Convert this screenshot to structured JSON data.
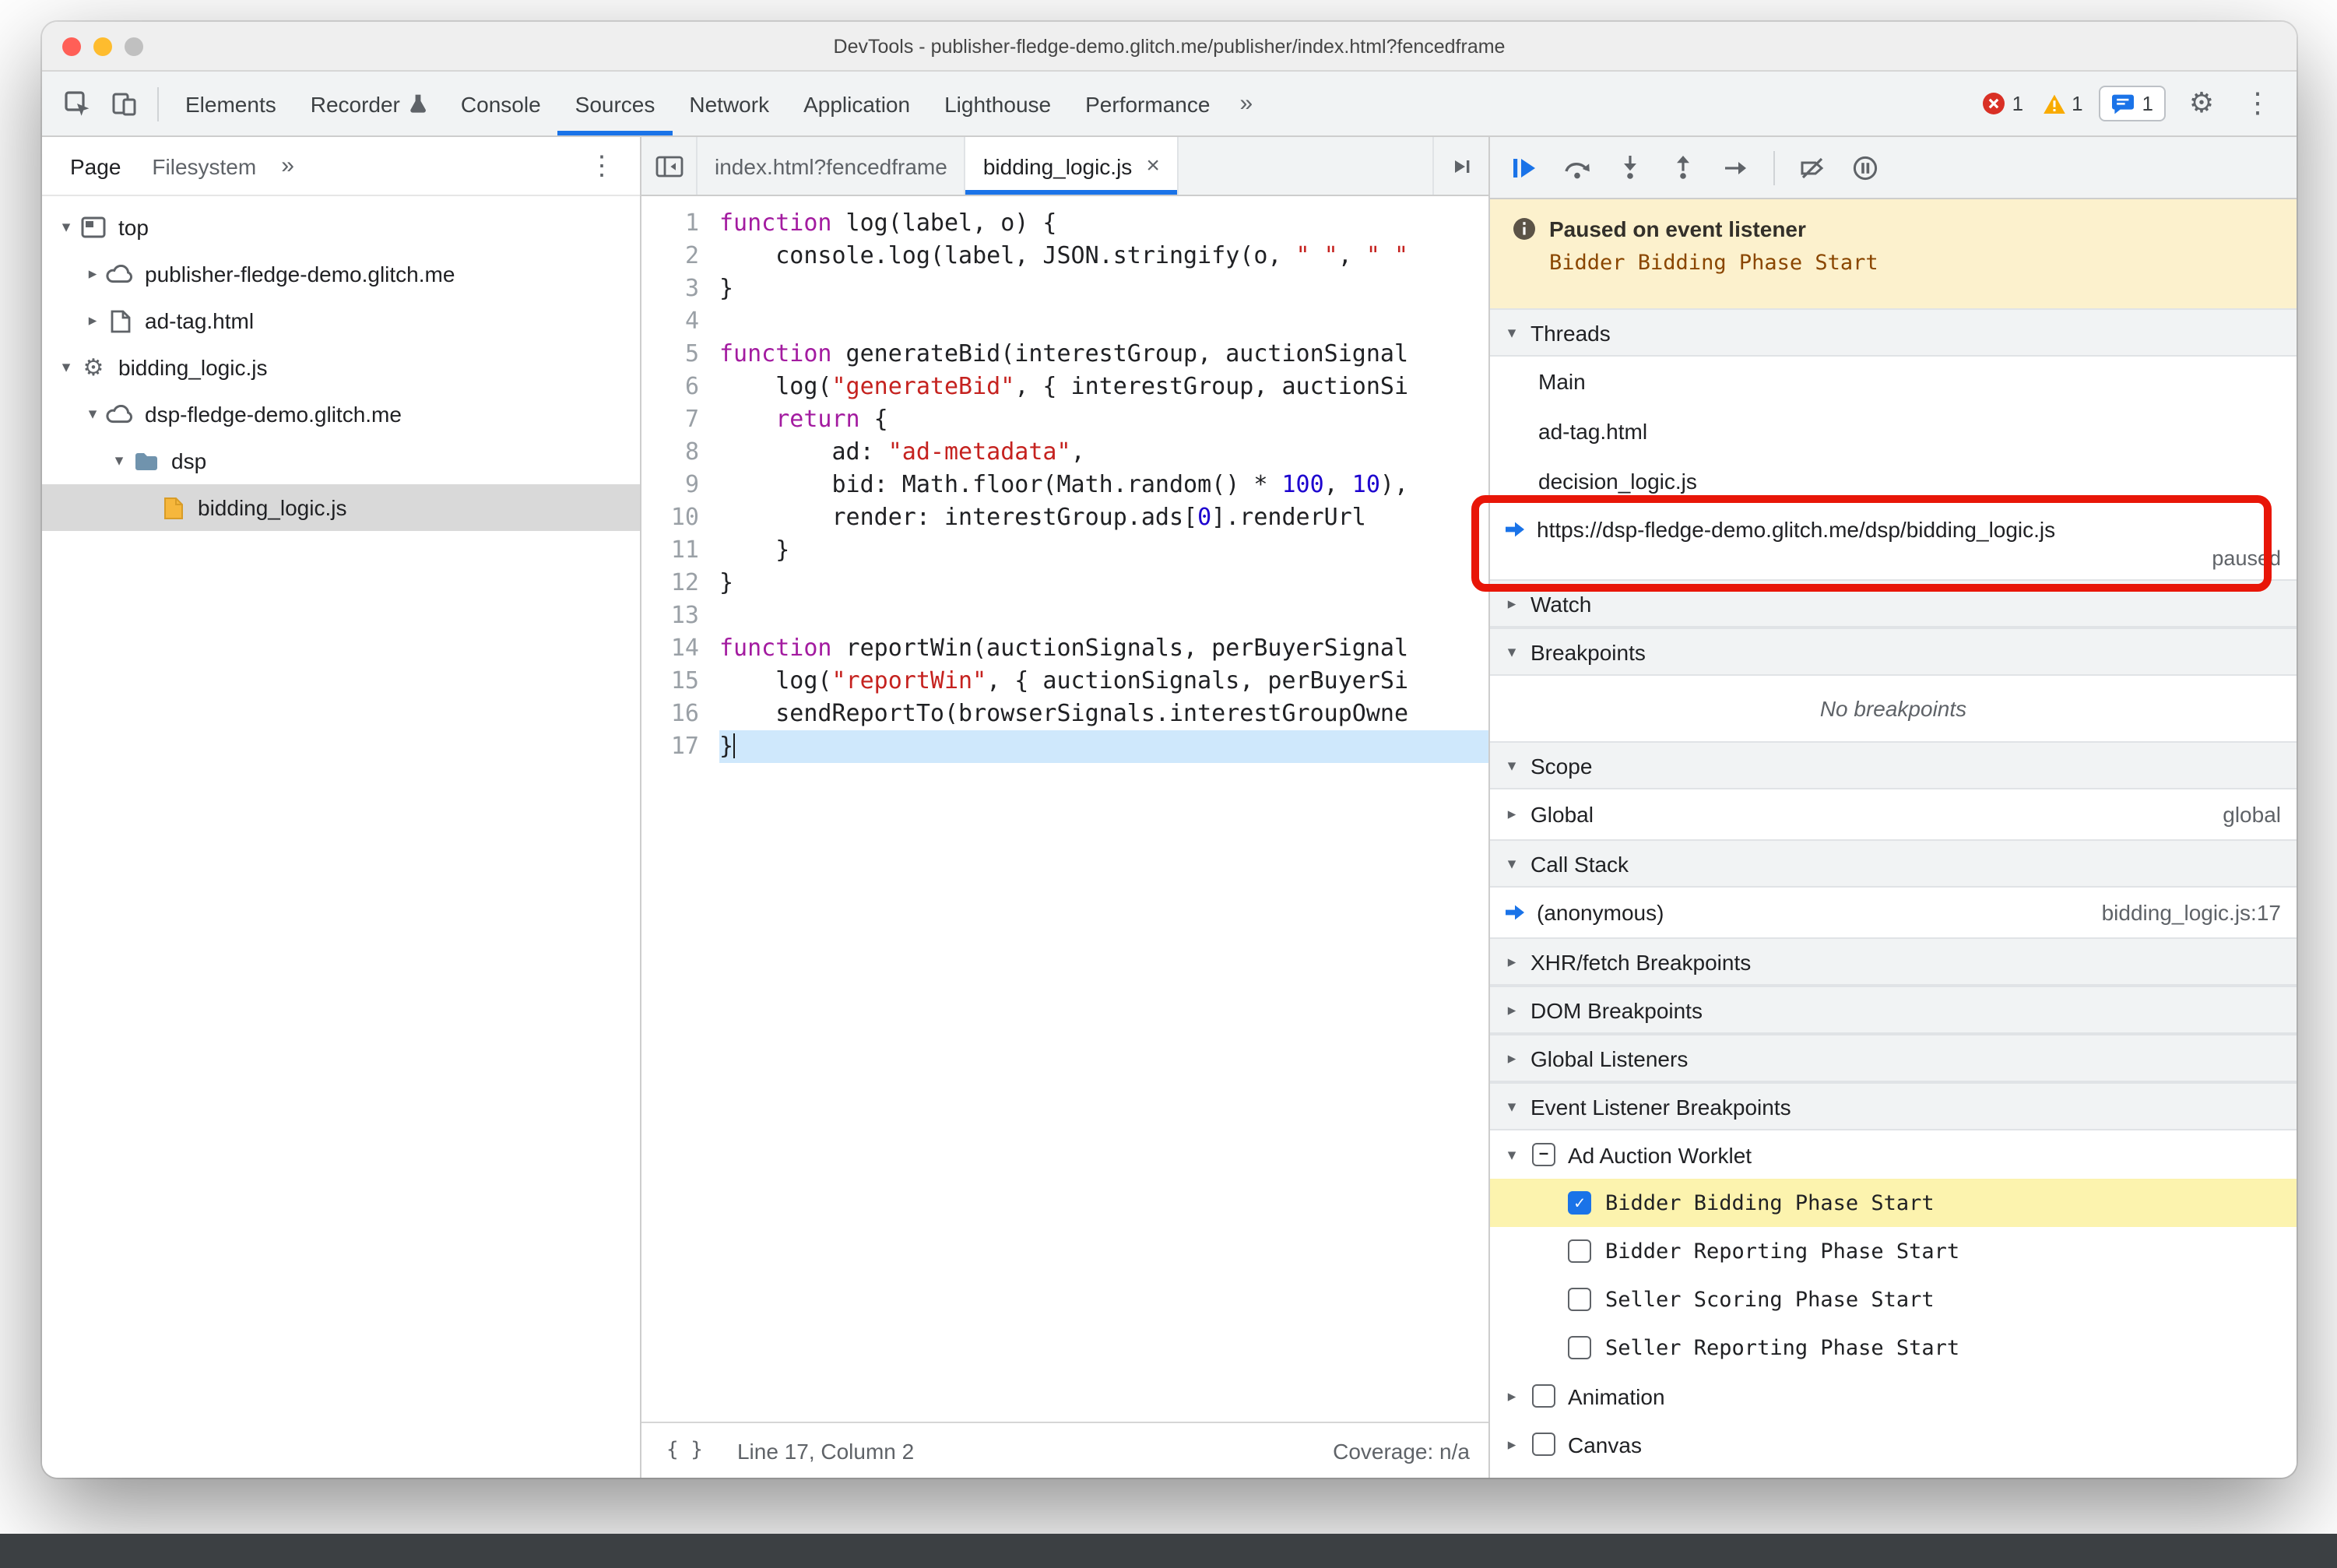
{
  "window": {
    "title": "DevTools - publisher-fledge-demo.glitch.me/publisher/index.html?fencedframe"
  },
  "colors": {
    "accent": "#1a73e8",
    "error_red": "#d93025",
    "warning_yellow": "#f9ab00",
    "annotation_red": "#e81608",
    "paused_banner_bg": "#fcf1cd",
    "paused_detail_text": "#8a4600",
    "event_highlight_bg": "#fcf3ae",
    "active_line_bg": "#cfe8fc",
    "selected_file_bg": "#d9d9d9",
    "syntax_keyword": "#a31ba0",
    "syntax_string": "#c5221f",
    "syntax_number": "#1c00cf",
    "syntax_plain": "#202124"
  },
  "toolbar": {
    "tabs": [
      {
        "label": "Elements"
      },
      {
        "label": "Recorder",
        "flask": true
      },
      {
        "label": "Console"
      },
      {
        "label": "Sources"
      },
      {
        "label": "Network"
      },
      {
        "label": "Application"
      },
      {
        "label": "Lighthouse"
      },
      {
        "label": "Performance"
      }
    ],
    "selected_tab": "Sources",
    "more_tabs": "»",
    "error_count": "1",
    "warning_count": "1",
    "issues_count": "1"
  },
  "sidebar": {
    "tabs": [
      "Page",
      "Filesystem"
    ],
    "more": "»",
    "tree": [
      {
        "label": "top",
        "depth": 0,
        "icon": "frame-icon",
        "state": "expanded"
      },
      {
        "label": "publisher-fledge-demo.glitch.me",
        "depth": 1,
        "icon": "cloud-icon",
        "state": "collapsed"
      },
      {
        "label": "ad-tag.html",
        "depth": 1,
        "icon": "document-icon",
        "state": "collapsed"
      },
      {
        "label": "bidding_logic.js",
        "depth": 0,
        "icon": "gear-icon",
        "state": "expanded"
      },
      {
        "label": "dsp-fledge-demo.glitch.me",
        "depth": 1,
        "icon": "cloud-icon",
        "state": "expanded"
      },
      {
        "label": "dsp",
        "depth": 2,
        "icon": "folder-icon",
        "state": "expanded"
      },
      {
        "label": "bidding_logic.js",
        "depth": 3,
        "icon": "file-icon",
        "state": "none",
        "selected": true
      }
    ]
  },
  "editor": {
    "tabs": [
      {
        "label": "index.html?fencedframe",
        "active": false,
        "closable": false
      },
      {
        "label": "bidding_logic.js",
        "active": true,
        "closable": true
      }
    ],
    "close_glyph": "×",
    "status": {
      "pretty_print": "{ }",
      "line_col": "Line 17, Column 2",
      "coverage": "Coverage: n/a"
    },
    "lines": [
      {
        "n": "1",
        "seg": [
          [
            "k",
            "function"
          ],
          [
            "p",
            " log(label, o) {"
          ]
        ]
      },
      {
        "n": "2",
        "seg": [
          [
            "p",
            "    console.log(label, JSON.stringify(o, "
          ],
          [
            "s",
            "\" \""
          ],
          [
            "p",
            ", "
          ],
          [
            "s",
            "\" \""
          ]
        ]
      },
      {
        "n": "3",
        "seg": [
          [
            "p",
            "}"
          ]
        ]
      },
      {
        "n": "4",
        "seg": []
      },
      {
        "n": "5",
        "seg": [
          [
            "k",
            "function"
          ],
          [
            "p",
            " generateBid(interestGroup, auctionSignal"
          ]
        ]
      },
      {
        "n": "6",
        "seg": [
          [
            "p",
            "    log("
          ],
          [
            "s",
            "\"generateBid\""
          ],
          [
            "p",
            ", { interestGroup, auctionSi"
          ]
        ]
      },
      {
        "n": "7",
        "seg": [
          [
            "p",
            "    "
          ],
          [
            "k",
            "return"
          ],
          [
            "p",
            " {"
          ]
        ]
      },
      {
        "n": "8",
        "seg": [
          [
            "p",
            "        ad: "
          ],
          [
            "s",
            "\"ad-metadata\""
          ],
          [
            "p",
            ","
          ]
        ]
      },
      {
        "n": "9",
        "seg": [
          [
            "p",
            "        bid: Math.floor(Math.random() * "
          ],
          [
            "n",
            "100"
          ],
          [
            "p",
            ", "
          ],
          [
            "n",
            "10"
          ],
          [
            "p",
            "),"
          ]
        ]
      },
      {
        "n": "10",
        "seg": [
          [
            "p",
            "        render: interestGroup.ads["
          ],
          [
            "n",
            "0"
          ],
          [
            "p",
            "].renderUrl"
          ]
        ]
      },
      {
        "n": "11",
        "seg": [
          [
            "p",
            "    }"
          ]
        ]
      },
      {
        "n": "12",
        "seg": [
          [
            "p",
            "}"
          ]
        ]
      },
      {
        "n": "13",
        "seg": []
      },
      {
        "n": "14",
        "seg": [
          [
            "k",
            "function"
          ],
          [
            "p",
            " reportWin(auctionSignals, perBuyerSignal"
          ]
        ]
      },
      {
        "n": "15",
        "seg": [
          [
            "p",
            "    log("
          ],
          [
            "s",
            "\"reportWin\""
          ],
          [
            "p",
            ", { auctionSignals, perBuyerSi"
          ]
        ]
      },
      {
        "n": "16",
        "seg": [
          [
            "p",
            "    sendReportTo(browserSignals.interestGroupOwne"
          ]
        ]
      },
      {
        "n": "17",
        "seg": [
          [
            "p",
            "}"
          ]
        ],
        "hl": true,
        "cursor": true
      }
    ]
  },
  "debugger": {
    "paused_banner": {
      "title": "Paused on event listener",
      "detail": "Bidder Bidding Phase Start"
    },
    "threads": {
      "label": "Threads",
      "items": [
        {
          "label": "Main"
        },
        {
          "label": "ad-tag.html"
        },
        {
          "label": "decision_logic.js"
        },
        {
          "label": "https://dsp-fledge-demo.glitch.me/dsp/bidding_logic.js",
          "status": "paused",
          "active": true
        }
      ]
    },
    "watch": {
      "label": "Watch"
    },
    "breakpoints": {
      "label": "Breakpoints",
      "empty": "No breakpoints"
    },
    "scope": {
      "label": "Scope",
      "rows": [
        {
          "label": "Global",
          "value": "global"
        }
      ]
    },
    "call_stack": {
      "label": "Call Stack",
      "rows": [
        {
          "label": "(anonymous)",
          "location": "bidding_logic.js:17",
          "active": true
        }
      ]
    },
    "xhr": {
      "label": "XHR/fetch Breakpoints"
    },
    "dom": {
      "label": "DOM Breakpoints"
    },
    "global_listeners": {
      "label": "Global Listeners"
    },
    "event_listener_breakpoints": {
      "label": "Event Listener Breakpoints",
      "categories": [
        {
          "label": "Ad Auction Worklet",
          "state": "indeterminate",
          "expanded": true,
          "events": [
            {
              "label": "Bidder Bidding Phase Start",
              "checked": true,
              "highlighted": true
            },
            {
              "label": "Bidder Reporting Phase Start",
              "checked": false
            },
            {
              "label": "Seller Scoring Phase Start",
              "checked": false
            },
            {
              "label": "Seller Reporting Phase Start",
              "checked": false
            }
          ]
        },
        {
          "label": "Animation",
          "state": "unchecked",
          "expanded": false,
          "events": []
        },
        {
          "label": "Canvas",
          "state": "unchecked",
          "expanded": false,
          "events": []
        }
      ]
    }
  }
}
